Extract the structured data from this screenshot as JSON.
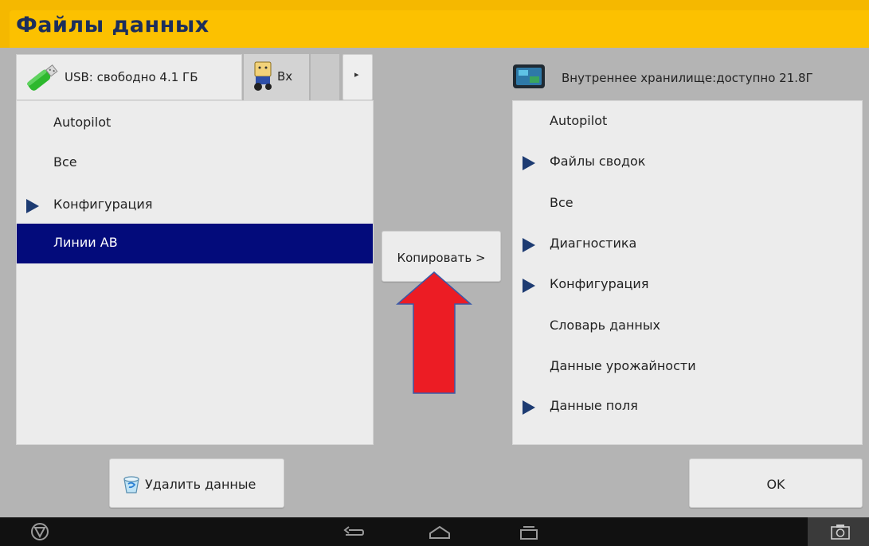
{
  "header": {
    "title": "Файлы данных"
  },
  "source_tabs": {
    "usb_label": "USB: свободно 4.1 ГБ",
    "vehicle_label": "Вх",
    "next_arrow": "▸"
  },
  "left_list": {
    "items": [
      {
        "label": "Autopilot",
        "expandable": false,
        "selected": false
      },
      {
        "label": "Все",
        "expandable": false,
        "selected": false
      },
      {
        "label": "Конфигурация",
        "expandable": true,
        "selected": false
      },
      {
        "label": "Линии AB",
        "expandable": false,
        "selected": true
      }
    ]
  },
  "copy_button": {
    "label": "Копировать >"
  },
  "storage": {
    "label": "Внутреннее хранилище:доступно 21.8Г"
  },
  "right_list": {
    "items": [
      {
        "label": "Autopilot",
        "expandable": false
      },
      {
        "label": "Файлы сводок",
        "expandable": true
      },
      {
        "label": "Все",
        "expandable": false
      },
      {
        "label": "Диагностика",
        "expandable": true
      },
      {
        "label": "Конфигурация",
        "expandable": true
      },
      {
        "label": "Словарь данных",
        "expandable": false
      },
      {
        "label": "Данные урожайности",
        "expandable": false
      },
      {
        "label": "Данные поля",
        "expandable": true
      }
    ]
  },
  "footer": {
    "delete_label": "Удалить данные",
    "ok_label": "OK"
  },
  "icons": {
    "usb": "usb-drive-icon",
    "vehicle": "tractor-icon",
    "storage": "display-icon",
    "delete": "trash-icon",
    "annotation": "red-arrow-up-icon"
  },
  "colors": {
    "title_bar": "#fcc100",
    "title_text": "#1c2e5c",
    "selection": "#030b7b",
    "expand_triangle": "#1d3b72",
    "annotation_arrow": "#ec1c24"
  }
}
